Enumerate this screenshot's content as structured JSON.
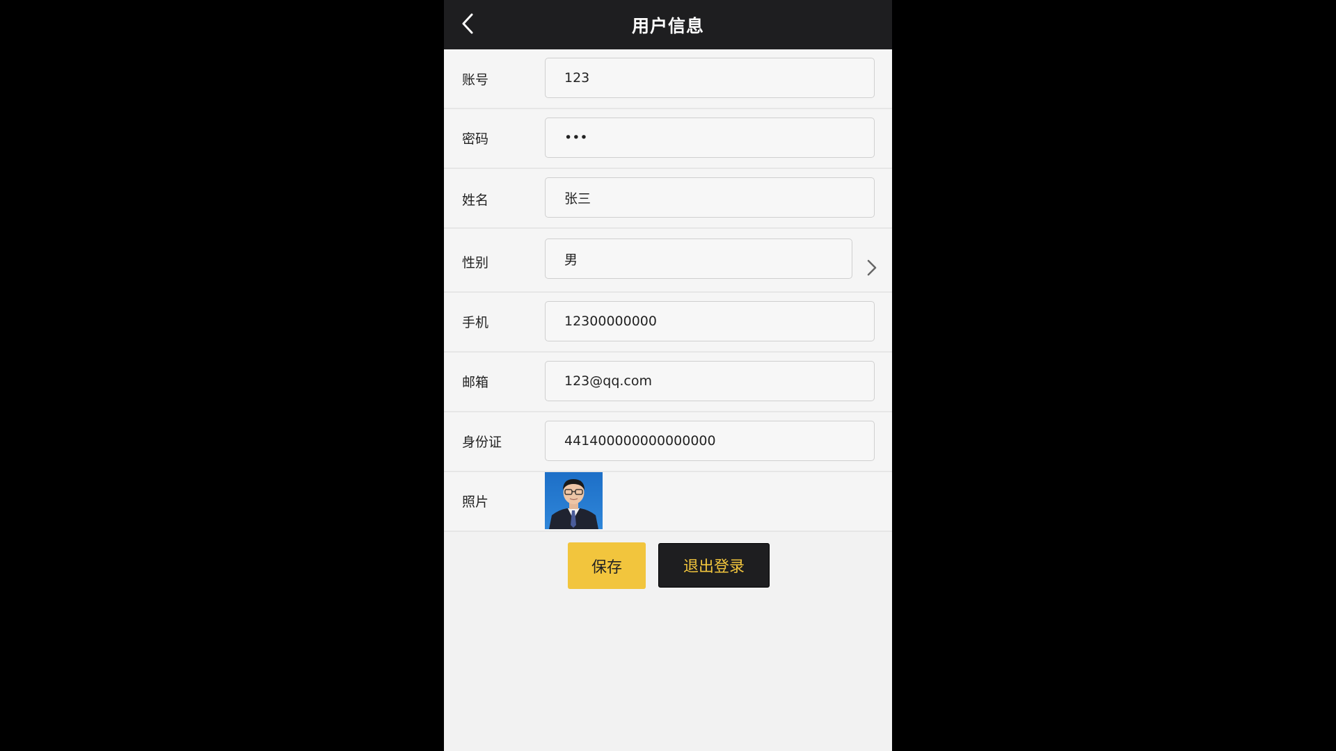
{
  "header": {
    "title": "用户信息",
    "back_icon": "chevron-left-icon"
  },
  "form": {
    "account": {
      "label": "账号",
      "value": "123"
    },
    "password": {
      "label": "密码",
      "value": "•••"
    },
    "name": {
      "label": "姓名",
      "value": "张三"
    },
    "gender": {
      "label": "性别",
      "value": "男",
      "icon": "chevron-right-icon"
    },
    "phone": {
      "label": "手机",
      "value": "12300000000"
    },
    "email": {
      "label": "邮箱",
      "value": "123@qq.com"
    },
    "id_card": {
      "label": "身份证",
      "value": "441400000000000000"
    },
    "photo": {
      "label": "照片"
    }
  },
  "actions": {
    "save_label": "保存",
    "logout_label": "退出登录"
  },
  "colors": {
    "page_background": "#000000",
    "header_background": "#1e1e20",
    "accent_yellow": "#f2c53d",
    "form_background": "#f5f5f5"
  }
}
